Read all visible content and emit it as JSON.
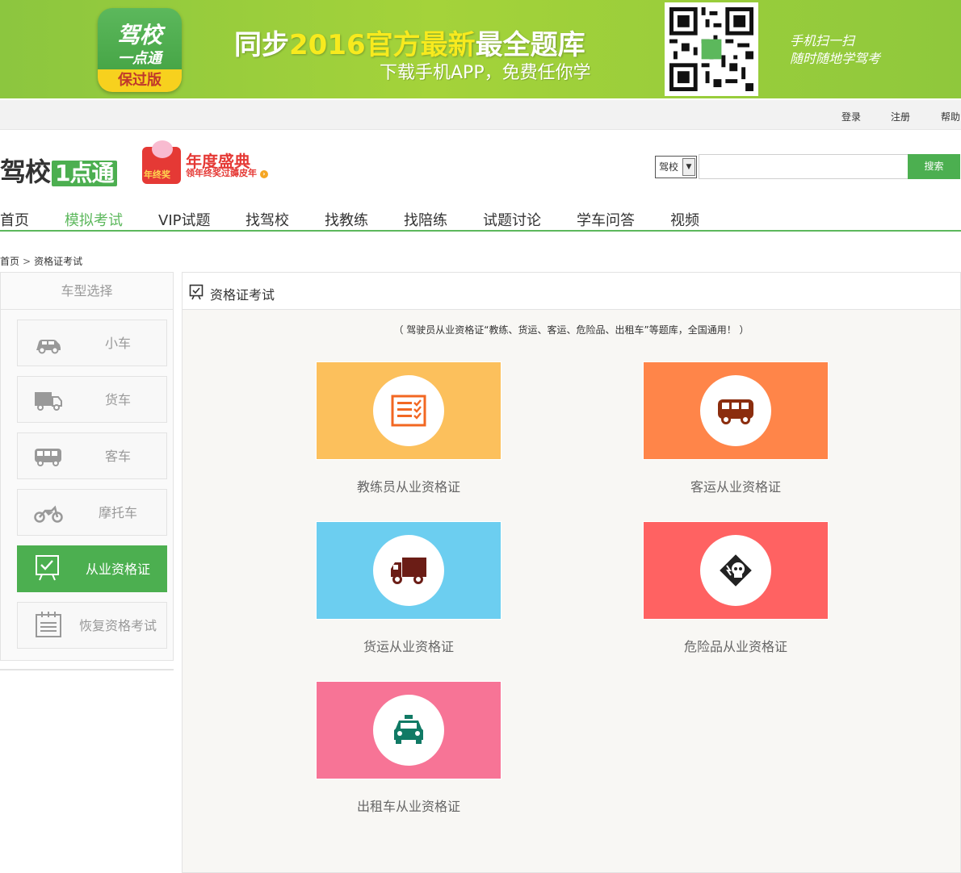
{
  "banner": {
    "app_title": "驾校",
    "app_sub": "一点通",
    "app_badge": "保过版",
    "headline_pre": "同步",
    "headline_hl": "2016官方最新",
    "headline_post": "最全题库",
    "subline": "下载手机APP，免费任你学",
    "qr_line1": "手机扫一扫",
    "qr_line2": "随时随地学驾考"
  },
  "topbar": {
    "login": "登录",
    "register": "注册",
    "help": "帮助"
  },
  "header": {
    "logo_text": "驾校",
    "logo_box": "1点通",
    "promo_title": "年度盛典",
    "promo_sub": "领年终奖过薅皮年",
    "promo_bag": "年终奖"
  },
  "search": {
    "select_value": "驾校",
    "input_value": "",
    "button": "搜索"
  },
  "nav": {
    "items": [
      "首页",
      "模拟考试",
      "VIP试题",
      "找驾校",
      "找教练",
      "找陪练",
      "试题讨论",
      "学车问答",
      "视频"
    ],
    "active_index": 1
  },
  "breadcrumb": {
    "home": "首页",
    "sep": ">",
    "current": "资格证考试"
  },
  "sidebar": {
    "title": "车型选择",
    "items": [
      {
        "label": "小车",
        "icon": "car-icon"
      },
      {
        "label": "货车",
        "icon": "truck-icon"
      },
      {
        "label": "客车",
        "icon": "bus-icon"
      },
      {
        "label": "摩托车",
        "icon": "motorcycle-icon"
      },
      {
        "label": "从业资格证",
        "icon": "certificate-icon"
      },
      {
        "label": "恢复资格考试",
        "icon": "calendar-icon"
      }
    ],
    "active_index": 4
  },
  "main": {
    "title": "资格证考试",
    "note": "（ 驾驶员从业资格证“教练、货运、客运、危险品、出租车”等题库，全国通用！ ）",
    "cards": [
      {
        "label": "教练员从业资格证",
        "color": "#fcc05c",
        "icon": "checklist-icon",
        "icon_color": "#f26722"
      },
      {
        "label": "客运从业资格证",
        "color": "#ff8549",
        "icon": "bus-icon",
        "icon_color": "#8b2d0e"
      },
      {
        "label": "货运从业资格证",
        "color": "#6ccef0",
        "icon": "truck-icon",
        "icon_color": "#6b1d16"
      },
      {
        "label": "危险品从业资格证",
        "color": "#ff6262",
        "icon": "hazard-skull-icon",
        "icon_color": "#222222"
      },
      {
        "label": "出租车从业资格证",
        "color": "#f77496",
        "icon": "taxi-icon",
        "icon_color": "#117a65"
      }
    ]
  },
  "colors": {
    "brand_green": "#4caf50",
    "nav_active": "#5cb85c"
  }
}
